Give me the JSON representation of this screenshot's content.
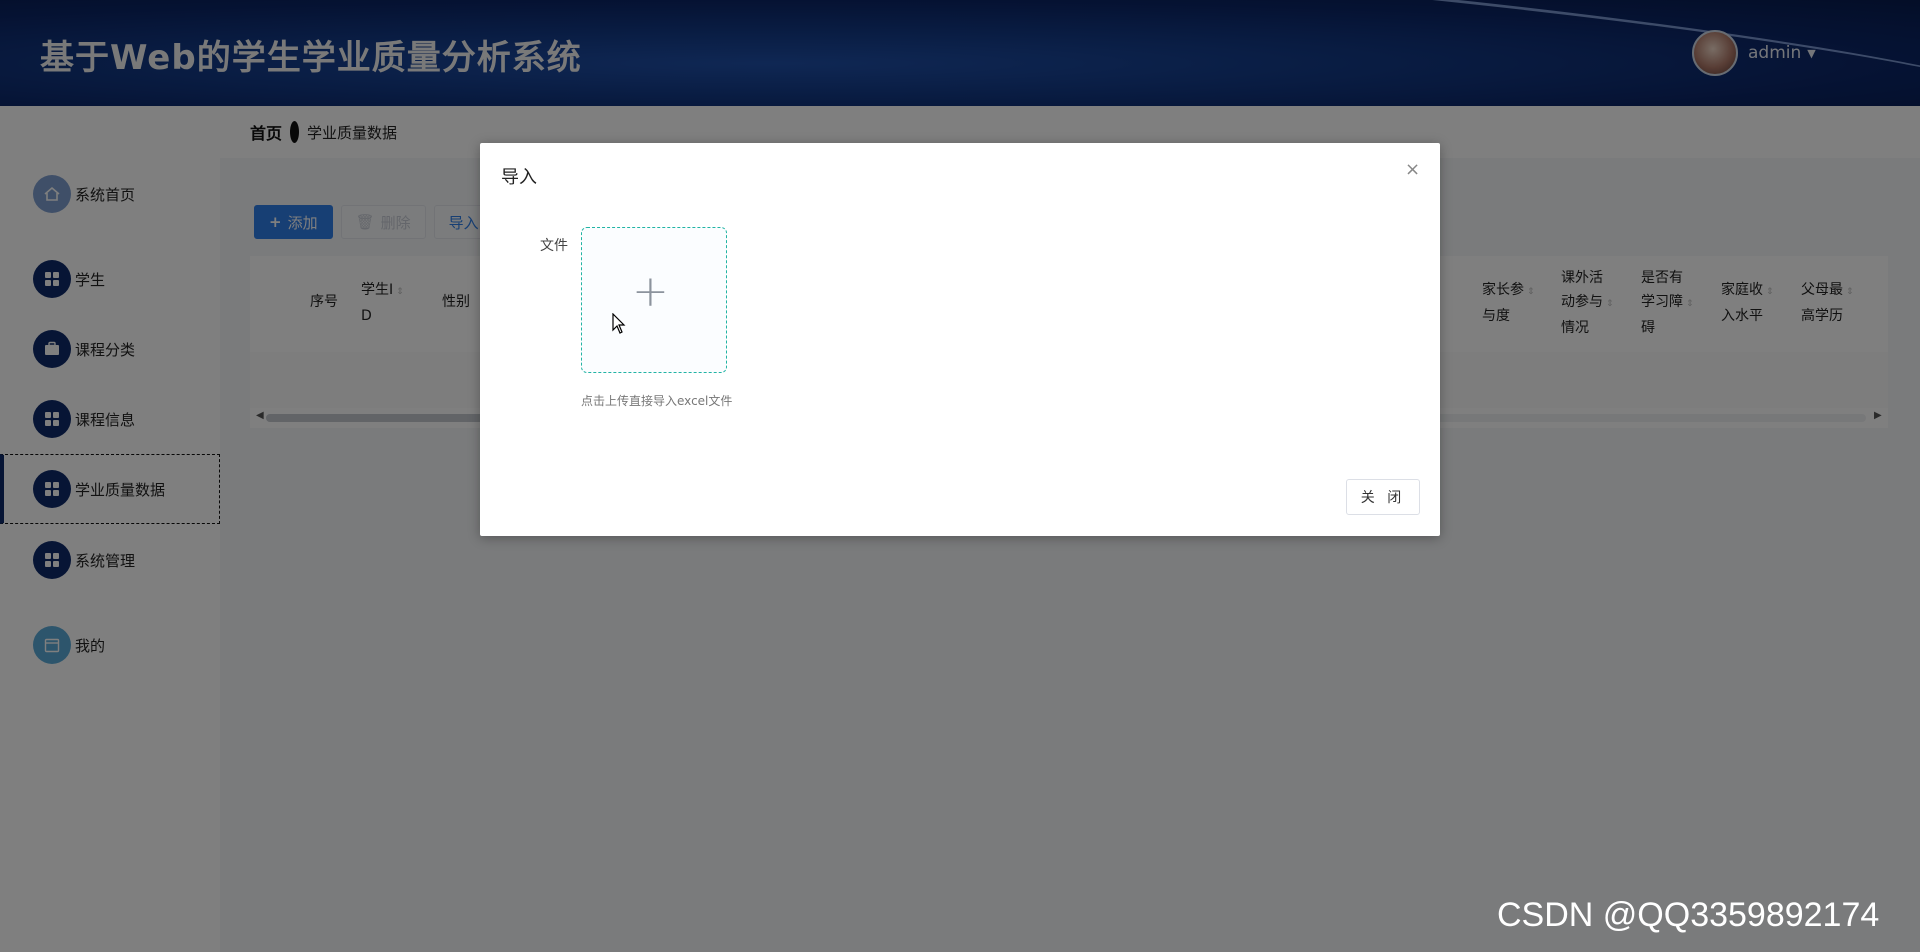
{
  "header": {
    "title": "基于Web的学生学业质量分析系统",
    "user": {
      "name": "admin"
    }
  },
  "sidebar": {
    "items": [
      {
        "label": "系统首页",
        "icon": "home-icon",
        "color": "#7f9fd0"
      },
      {
        "label": "学生",
        "icon": "grid-icon",
        "color": "#0e2a6b"
      },
      {
        "label": "课程分类",
        "icon": "briefcase-icon",
        "color": "#0e2a6b"
      },
      {
        "label": "课程信息",
        "icon": "grid-icon",
        "color": "#0e2a6b"
      },
      {
        "label": "学业质量数据",
        "icon": "grid-icon",
        "color": "#0e2a6b",
        "active": true
      },
      {
        "label": "系统管理",
        "icon": "grid-icon",
        "color": "#0e2a6b"
      },
      {
        "label": "我的",
        "icon": "calendar-icon",
        "color": "#5aaad8"
      }
    ]
  },
  "breadcrumb": {
    "home": "首页",
    "current": "学业质量数据"
  },
  "toolbar": {
    "add": "添加",
    "delete": "删除",
    "import": "导入"
  },
  "table": {
    "columns_left": [
      {
        "line1": "序号",
        "line2": ""
      },
      {
        "line1": "学生I",
        "line2": "D"
      },
      {
        "line1": "性别",
        "line2": ""
      }
    ],
    "columns_right": [
      {
        "line1": "家长参",
        "line2": "与度",
        "line3": ""
      },
      {
        "line1": "课外活",
        "line2": "动参与",
        "line3": "情况"
      },
      {
        "line1": "是否有",
        "line2": "学习障",
        "line3": "碍"
      },
      {
        "line1": "家庭收",
        "line2": "入水平",
        "line3": ""
      },
      {
        "line1": "父母最",
        "line2": "高学历",
        "line3": ""
      }
    ]
  },
  "dialog": {
    "title": "导入",
    "file_label": "文件",
    "upload_tip": "点击上传直接导入excel文件",
    "close_button": "关 闭"
  },
  "watermark": "CSDN @QQ3359892174",
  "colors": {
    "primary": "#2f7fe8",
    "sidebar_icon": "#0e2a6b",
    "upload_border": "#22b4a4"
  }
}
